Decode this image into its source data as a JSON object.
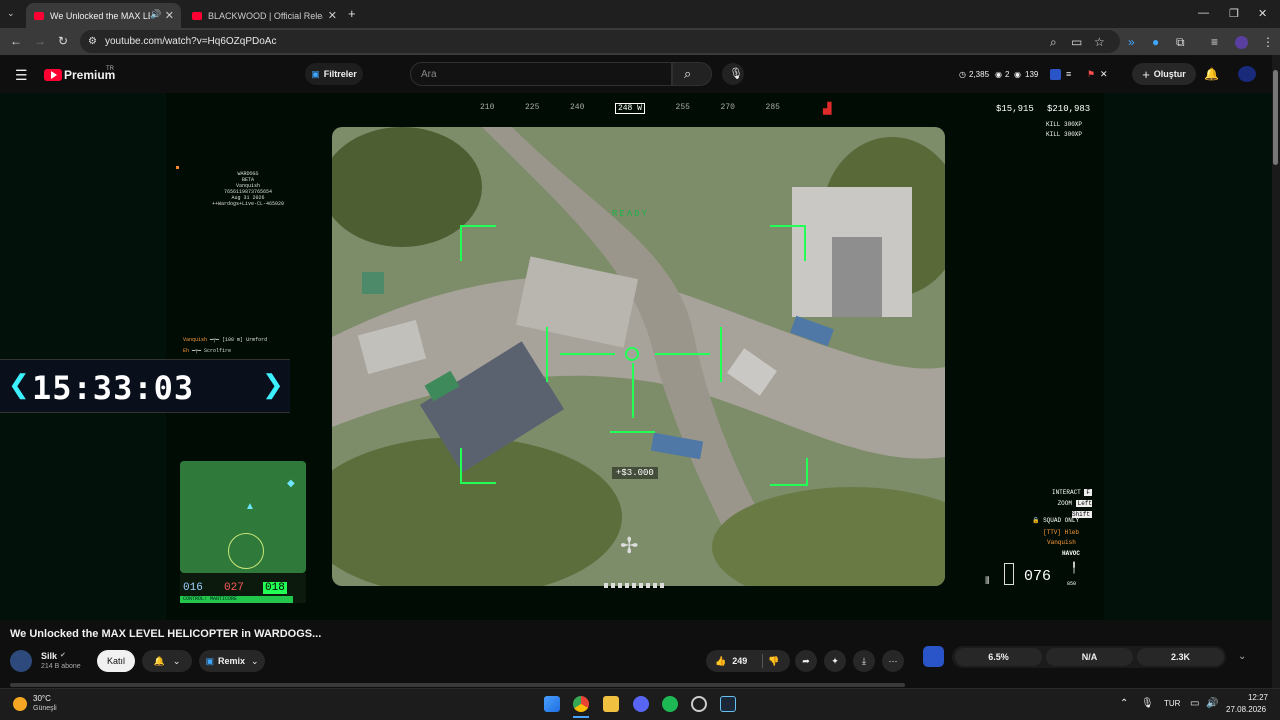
{
  "browser": {
    "tabs": [
      {
        "label": "We Unlocked the MAX LEVE"
      },
      {
        "label": "BLACKWOOD | Official Release"
      }
    ],
    "url": "youtube.com/watch?v=Hq6OZqPDoAc",
    "new_tab": "+"
  },
  "youtube": {
    "logo_text": "Premium",
    "region_badge": "TR",
    "filters_label": "Filtreler",
    "search_placeholder": "Ara",
    "stats": {
      "a": "2,385",
      "b": "2",
      "c": "139"
    },
    "create_label": "Oluştur"
  },
  "hud": {
    "compass": [
      "210",
      "225",
      "240",
      "248 W",
      "255",
      "270",
      "285"
    ],
    "money": "$15,915",
    "total": "$210,983",
    "kill_lines": [
      "KILL  300XP",
      "KILL  300XP"
    ],
    "ready": "READY",
    "reward": "+$3.000",
    "interact": "INTERACT",
    "interact_key": "F",
    "zoom": "ZOOM",
    "zoom_key": "Left Shift",
    "squad_only": "SQUAD ONLY",
    "squad_members": [
      "[TTV] Hleb",
      "Vanquish"
    ],
    "vehicle": "HAVOC",
    "ammo": "076",
    "ammo_reserve": "850",
    "watermark_lines": [
      "WARDOGS",
      "BETA",
      "Vanquish",
      "7656119873765654",
      "Aug 31 2026",
      "++Wardogs+Live-CL-465020"
    ],
    "killfeed": [
      "Vanquish",
      "[100 m]",
      "Urmford",
      "Eh",
      "Scrolfire"
    ],
    "timer": "15:33:03",
    "minimap_values": [
      "016",
      "027",
      "018"
    ],
    "minimap_label": "CONTROL: MANTICORE"
  },
  "video": {
    "title": "We Unlocked the MAX LEVEL HELICOPTER in WARDOGS...",
    "channel": "Silk",
    "subscribers": "214 B abone",
    "join_label": "Katıl",
    "remix_label": "Remix",
    "likes": "249",
    "ext_stats": [
      "6.5%",
      "N/A",
      "2.3K"
    ]
  },
  "taskbar": {
    "weather_temp": "30°C",
    "weather_desc": "Güneşli",
    "lang": "TUR",
    "time": "12:27",
    "date": "27.08.2026"
  },
  "colors": {
    "youtube_red": "#ff0033",
    "hud_green": "#22ff55",
    "accent_blue": "#3ea6ff"
  }
}
